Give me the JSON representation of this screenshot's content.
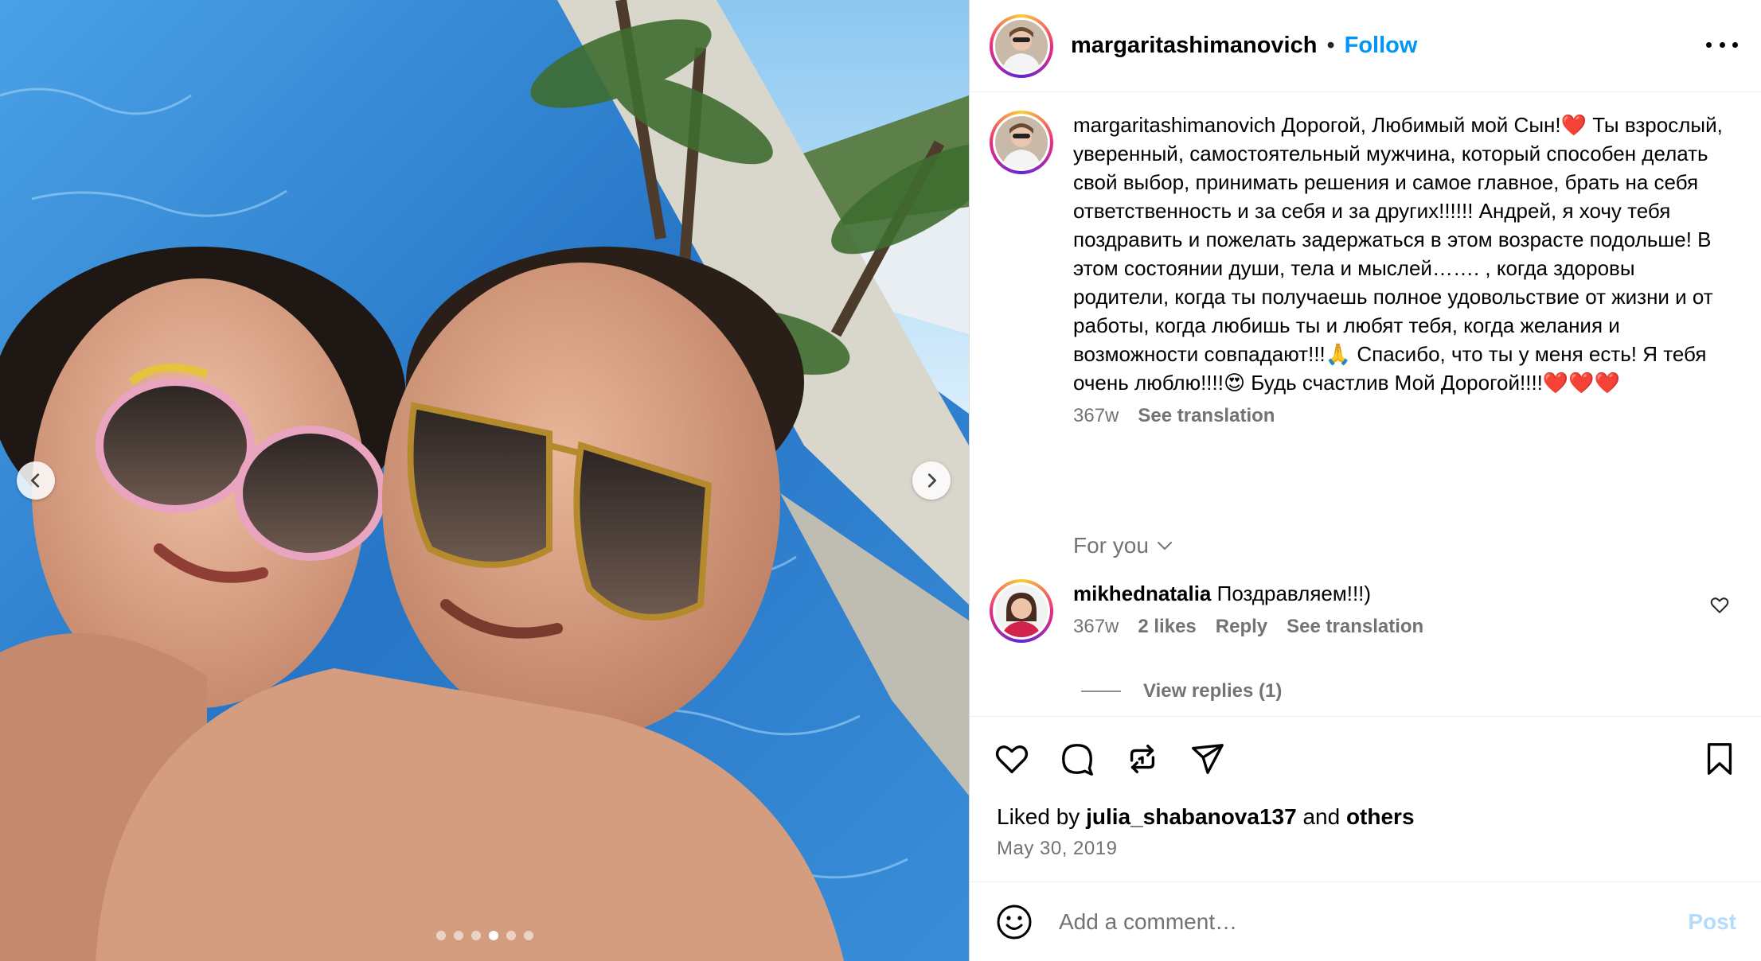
{
  "media": {
    "carousel_count": 6,
    "carousel_active_index": 3
  },
  "header": {
    "username": "margaritashimanovich",
    "separator": "•",
    "follow_label": "Follow"
  },
  "caption": {
    "username": "margaritashimanovich",
    "text": "Дорогой, Любимый мой Сын!❤️ Ты взрослый, уверенный, самостоятельный мужчина, который способен делать свой выбор, принимать решения и самое главное, брать на себя ответственность и за себя и за других!!!!!! Андрей, я хочу тебя поздравить и пожелать задержаться в этом возрасте подольше! В этом состоянии души, тела и мыслей……. , когда здоровы родители, когда ты получаешь полное удовольствие от жизни и от работы, когда любишь ты и любят тебя, когда желания и возможности совпадают!!!🙏 Спасибо, что ты у меня есть! Я тебя очень люблю!!!!😍 Будь счастлив Мой Дорогой!!!!❤️❤️❤️",
    "age": "367w",
    "see_translation": "See translation"
  },
  "for_you": {
    "label": "For you"
  },
  "comment": {
    "username": "mikhednatalia",
    "text": "Поздравляем!!!)",
    "age": "367w",
    "likes": "2 likes",
    "reply_label": "Reply",
    "see_translation": "See translation",
    "view_replies": "View replies (1)"
  },
  "likes": {
    "prefix": "Liked by",
    "user": "julia_shabanova137",
    "and": "and",
    "others": "others"
  },
  "date": "May 30, 2019",
  "add_comment": {
    "placeholder": "Add a comment…",
    "post_label": "Post"
  },
  "colors": {
    "accent": "#0095f6",
    "muted": "#737373",
    "post_disabled": "#b3dbff"
  }
}
